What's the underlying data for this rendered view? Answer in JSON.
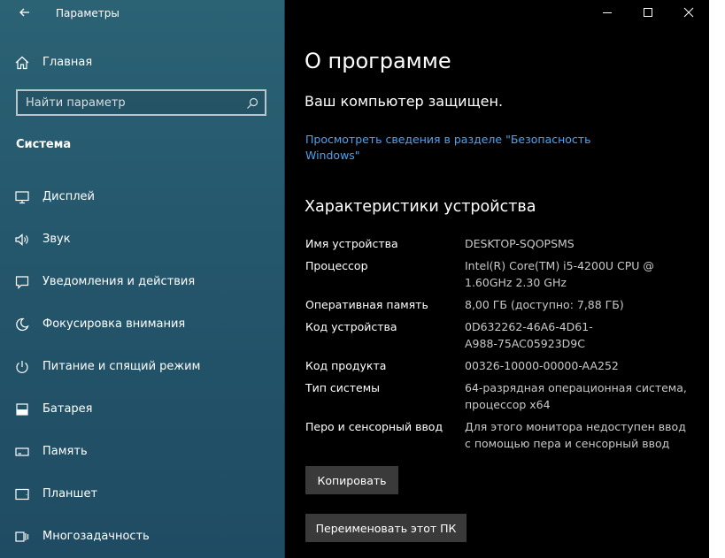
{
  "app": {
    "title": "Параметры"
  },
  "sidebar": {
    "home_label": "Главная",
    "search_placeholder": "Найти параметр",
    "section_label": "Система",
    "items": [
      {
        "label": "Дисплей",
        "icon": "display-icon"
      },
      {
        "label": "Звук",
        "icon": "speaker-icon"
      },
      {
        "label": "Уведомления и действия",
        "icon": "notification-icon"
      },
      {
        "label": "Фокусировка внимания",
        "icon": "moon-icon"
      },
      {
        "label": "Питание и спящий режим",
        "icon": "power-icon"
      },
      {
        "label": "Батарея",
        "icon": "battery-icon"
      },
      {
        "label": "Память",
        "icon": "storage-icon"
      },
      {
        "label": "Планшет",
        "icon": "tablet-icon"
      },
      {
        "label": "Многозадачность",
        "icon": "multitasking-icon"
      }
    ]
  },
  "main": {
    "title": "О программе",
    "protection_status": "Ваш компьютер защищен.",
    "security_link": "Просмотреть сведения в разделе \"Безопасность Windows\"",
    "specs_title": "Характеристики устройства",
    "specs": [
      {
        "label": "Имя устройства",
        "value": "DESKTOP-SQOPSMS"
      },
      {
        "label": "Процессор",
        "value": "Intel(R) Core(TM) i5-4200U CPU @ 1.60GHz   2.30 GHz"
      },
      {
        "label": "Оперативная память",
        "value": "8,00 ГБ (доступно: 7,88 ГБ)"
      },
      {
        "label": "Код устройства",
        "value": "0D632262-46A6-4D61-A988-75AC05923D9C"
      },
      {
        "label": "Код продукта",
        "value": "00326-10000-00000-AA252"
      },
      {
        "label": "Тип системы",
        "value": "64-разрядная операционная система, процессор x64"
      },
      {
        "label": "Перо и сенсорный ввод",
        "value": "Для этого монитора недоступен ввод с помощью пера и сенсорный ввод"
      }
    ],
    "copy_button": "Копировать",
    "rename_button": "Переименовать этот ПК"
  },
  "colors": {
    "sidebar_bg": "#275a6d",
    "content_bg": "#000000",
    "link": "#4aa3f0",
    "button_bg": "#3a3a3a"
  }
}
